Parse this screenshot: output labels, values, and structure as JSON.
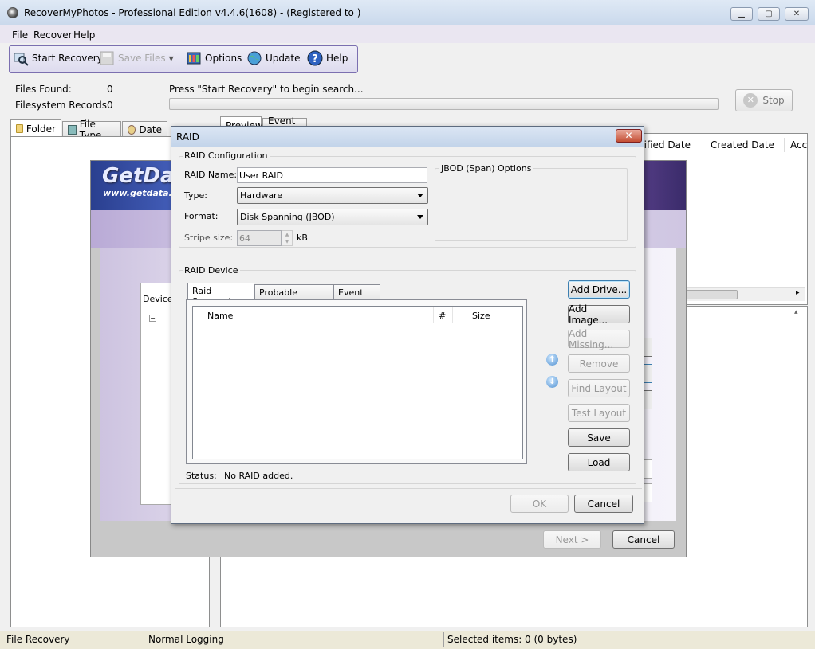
{
  "window": {
    "title": "RecoverMyPhotos - Professional Edition v4.4.6(1608)  -  (Registered to )",
    "min_label": "▁",
    "max_label": "▢",
    "close_label": "✕"
  },
  "menu": [
    "File",
    "Recover",
    "Help"
  ],
  "toolbar": {
    "start_recovery": "Start Recovery",
    "save_files": "Save Files",
    "options": "Options",
    "update": "Update",
    "help": "Help"
  },
  "stats": {
    "files_found_label": "Files Found:",
    "files_found_value": "0",
    "fs_records_label": "Filesystem Records:",
    "fs_records_value": "0",
    "status_message": "Press \"Start Recovery\" to begin search...",
    "stop_label": "Stop"
  },
  "left_tabs": [
    "Folder",
    "File Type",
    "Date"
  ],
  "right_tabs": [
    "Preview",
    "Event Log"
  ],
  "file_columns": [
    "dified Date",
    "Created Date",
    "Acc"
  ],
  "wizard": {
    "logo": "GetData",
    "url": "www.getdata.com",
    "device_label": "Device",
    "next_label": "Next >",
    "cancel_label": "Cancel"
  },
  "raid": {
    "title": "RAID",
    "config_group": "RAID Configuration",
    "name_label": "RAID Name:",
    "name_value": "User RAID",
    "type_label": "Type:",
    "type_value": "Hardware",
    "format_label": "Format:",
    "format_value": "Disk Spanning (JBOD)",
    "stripe_label": "Stripe size:",
    "stripe_value": "64",
    "stripe_unit": "kB",
    "jbod_group": "JBOD (Span) Options",
    "device_group": "RAID Device",
    "tabs": [
      "Raid Segments",
      "Probable Solutions",
      "Event Log"
    ],
    "columns": [
      "Name",
      "#",
      "Size"
    ],
    "buttons": {
      "add_drive": "Add Drive...",
      "add_image": "Add Image...",
      "add_missing": "Add Missing...",
      "remove": "Remove",
      "find_layout": "Find Layout",
      "test_layout": "Test Layout",
      "save": "Save",
      "load": "Load"
    },
    "status_label": "Status:",
    "status_value": "No RAID added.",
    "ok_label": "OK",
    "cancel_label": "Cancel"
  },
  "statusbar": {
    "mode": "File Recovery",
    "logging": "Normal Logging",
    "selected": "Selected items: 0 (0 bytes)"
  }
}
